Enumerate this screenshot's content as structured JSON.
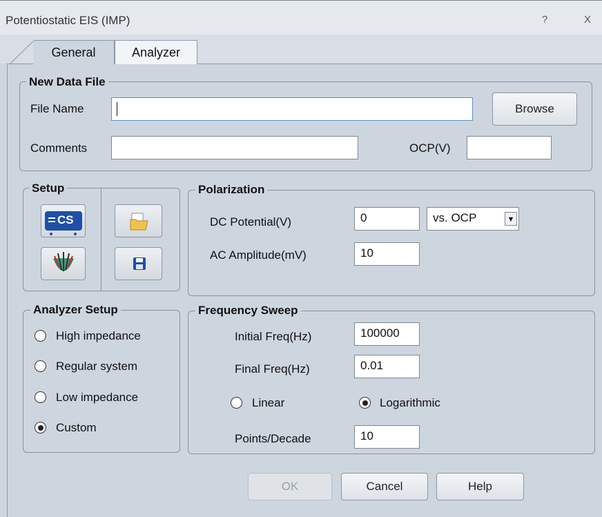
{
  "window": {
    "title": "Potentiostatic EIS (IMP)",
    "help_glyph": "?",
    "close_glyph": "X"
  },
  "tabs": [
    {
      "label": "General"
    },
    {
      "label": "Analyzer"
    }
  ],
  "new_data_file": {
    "legend": "New Data File",
    "file_name_label": "File Name",
    "file_name_value": "",
    "browse_label": "Browse",
    "comments_label": "Comments",
    "comments_value": "",
    "ocp_label": "OCP(V)",
    "ocp_value": ""
  },
  "setup": {
    "legend": "Setup",
    "icons": [
      "cs-instrument-icon",
      "open-folder-icon",
      "electrode-cell-icon",
      "save-disk-icon"
    ],
    "cs_text": "CS"
  },
  "polarization": {
    "legend": "Polarization",
    "dc_label": "DC Potential(V)",
    "dc_value": "0",
    "ref_selected": "vs. OCP",
    "ac_label": "AC Amplitude(mV)",
    "ac_value": "10"
  },
  "analyzer_setup": {
    "legend": "Analyzer Setup",
    "options": [
      {
        "label": "High impedance",
        "selected": false
      },
      {
        "label": "Regular system",
        "selected": false
      },
      {
        "label": "Low impedance",
        "selected": false
      },
      {
        "label": "Custom",
        "selected": true
      }
    ]
  },
  "frequency_sweep": {
    "legend": "Frequency Sweep",
    "initial_label": "Initial Freq(Hz)",
    "initial_value": "100000",
    "final_label": "Final Freq(Hz)",
    "final_value": "0.01",
    "linear_label": "Linear",
    "log_label": "Logarithmic",
    "selected_scale": "Logarithmic",
    "points_label": "Points/Decade",
    "points_value": "10"
  },
  "footer": {
    "ok_label": "OK",
    "cancel_label": "Cancel",
    "help_label": "Help"
  }
}
